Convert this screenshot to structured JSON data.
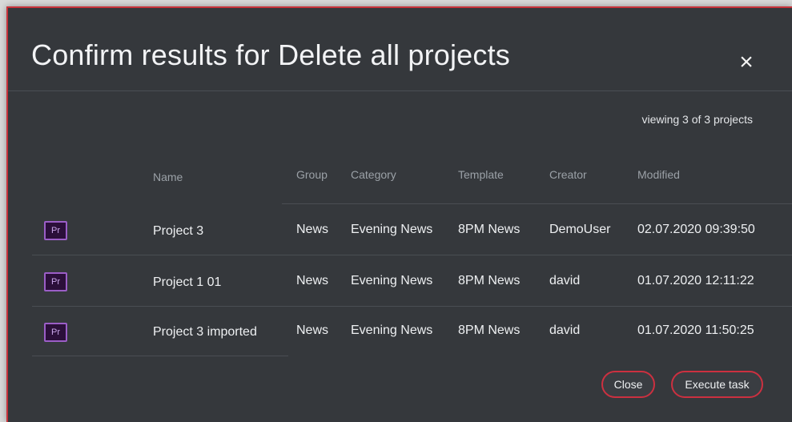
{
  "dialog": {
    "title": "Confirm results for Delete all projects",
    "close_icon": "×",
    "viewing": "viewing 3 of 3 projects"
  },
  "table": {
    "headers": [
      "Name",
      "Group",
      "Category",
      "Template",
      "Creator",
      "Modified"
    ],
    "rows": [
      {
        "icon": "Pr",
        "name": "Project 3",
        "group": "News",
        "category": "Evening News",
        "template": "8PM News",
        "creator": "DemoUser",
        "modified": "02.07.2020 09:39:50"
      },
      {
        "icon": "Pr",
        "name": "Project 1 01",
        "group": "News",
        "category": "Evening News",
        "template": "8PM News",
        "creator": "david",
        "modified": "01.07.2020 12:11:22"
      },
      {
        "icon": "Pr",
        "name": "Project 3 imported",
        "group": "News",
        "category": "Evening News",
        "template": "8PM News",
        "creator": "david",
        "modified": "01.07.2020 11:50:25"
      }
    ]
  },
  "buttons": {
    "close": "Close",
    "execute": "Execute task"
  },
  "colors": {
    "accent": "#cc3040",
    "background": "#35383c",
    "premiere_icon": "#9b5ec7"
  }
}
